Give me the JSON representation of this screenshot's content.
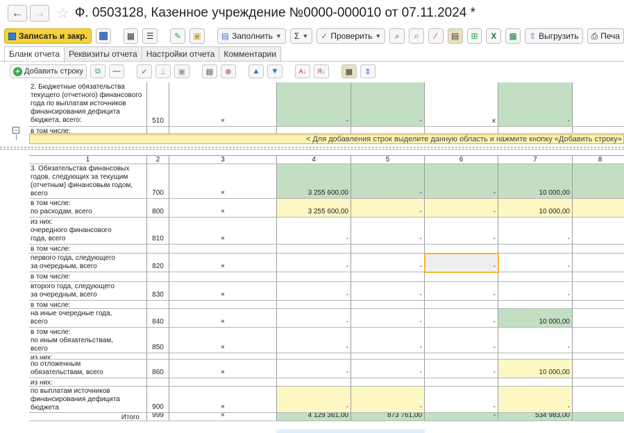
{
  "header": {
    "back_glyph": "←",
    "forward_glyph": "→",
    "star_glyph": "☆",
    "title": "Ф. 0503128, Казенное учреждение №0000-000010 от 07.11.2024 *"
  },
  "toolbar": {
    "save_close": "Записать и закр.",
    "fill": "Заполнить",
    "check": "Проверить",
    "export": "Выгрузить",
    "print": "Печа"
  },
  "tabs": [
    "Бланк отчета",
    "Реквизиты отчета",
    "Настройки отчета",
    "Комментарии"
  ],
  "form_toolbar": {
    "add_row": "Добавить строку"
  },
  "banner": "< Для добавления строк выделите данную область и нажмите кнопку «Добавить строку»",
  "column_numbers": [
    "1",
    "2",
    "3",
    "4",
    "5",
    "6",
    "7",
    "8"
  ],
  "top_rows": [
    {
      "label": "2. Бюджетные обязательства\nтекущего (отчетного) финансового\nгода по выплатам источников\nфинансирования дефицита\nбюджета, всего:",
      "code": "510",
      "c3": "×",
      "v4": "-",
      "v5": "-",
      "v6": "x",
      "v7": "-",
      "v8": ""
    },
    {
      "label": "  в том числе:",
      "code": "",
      "c3": "",
      "v4": "",
      "v5": "",
      "v6": "",
      "v7": "",
      "v8": ""
    }
  ],
  "rows": [
    {
      "label": "3. Обязательства финансовых\nгодов, следующих за текущим\n(отчетным) финансовым годом,\nвсего",
      "code": "700",
      "c3": "×",
      "v4": "3 255 600,00",
      "v5": "-",
      "v6": "-",
      "v7": "10 000,00",
      "v8": ""
    },
    {
      "label": "  в том числе:\n    по расходам, всего",
      "code": "800",
      "c3": "×",
      "v4": "3 255 600,00",
      "v5": "-",
      "v6": "-",
      "v7": "10 000,00",
      "v8": ""
    },
    {
      "label": "        из них:\n      очередного финансового\n      года, всего",
      "code": "810",
      "c3": "×",
      "v4": "-",
      "v5": "-",
      "v6": "-",
      "v7": "-",
      "v8": ""
    },
    {
      "label": "        в том числе:",
      "code": "",
      "c3": "",
      "v4": "",
      "v5": "",
      "v6": "",
      "v7": "",
      "v8": ""
    },
    {
      "label": "      первого года, следующего\n      за очередным, всего",
      "code": "820",
      "c3": "×",
      "v4": "-",
      "v5": "-",
      "v6": "-",
      "v7": "-",
      "v8": ""
    },
    {
      "label": "        в том числе:",
      "code": "",
      "c3": "",
      "v4": "",
      "v5": "",
      "v6": "",
      "v7": "",
      "v8": ""
    },
    {
      "label": "      второго года, следующего\n      за очередным, всего",
      "code": "830",
      "c3": "×",
      "v4": "-",
      "v5": "-",
      "v6": "-",
      "v7": "-",
      "v8": ""
    },
    {
      "label": "        в том числе:",
      "code": "",
      "c3": "",
      "v4": "",
      "v5": "",
      "v6": "",
      "v7": "",
      "v8": ""
    },
    {
      "label": "      на иные очередные года,\n      всего",
      "code": "840",
      "c3": "×",
      "v4": "-",
      "v5": "-",
      "v6": "-",
      "v7": "10 000,00",
      "v8": ""
    },
    {
      "label": "        в том числе:\n        по иным обязательствам,\n        всего",
      "code": "850",
      "c3": "×",
      "v4": "-",
      "v5": "-",
      "v6": "-",
      "v7": "-",
      "v8": ""
    },
    {
      "label": "          из них:",
      "code": "",
      "c3": "",
      "v4": "",
      "v5": "",
      "v6": "",
      "v7": "",
      "v8": ""
    },
    {
      "label": "        по отложенным\n        обязательствам, всего",
      "code": "860",
      "c3": "×",
      "v4": "-",
      "v5": "-",
      "v6": "-",
      "v7": "10 000,00",
      "v8": ""
    },
    {
      "label": "          из них:",
      "code": "",
      "c3": "",
      "v4": "",
      "v5": "",
      "v6": "",
      "v7": "",
      "v8": ""
    },
    {
      "label": "    по выплатам источников\n    финансирования дефицита\n    бюджета",
      "code": "900",
      "c3": "×",
      "v4": "-",
      "v5": "-",
      "v6": "-",
      "v7": "-",
      "v8": ""
    },
    {
      "label": "Итого",
      "code": "999",
      "c3": "×",
      "v4": "4 129 361,00",
      "v5": "873 761,00",
      "v6": "-",
      "v7": "534 983,00",
      "v8": ""
    }
  ]
}
